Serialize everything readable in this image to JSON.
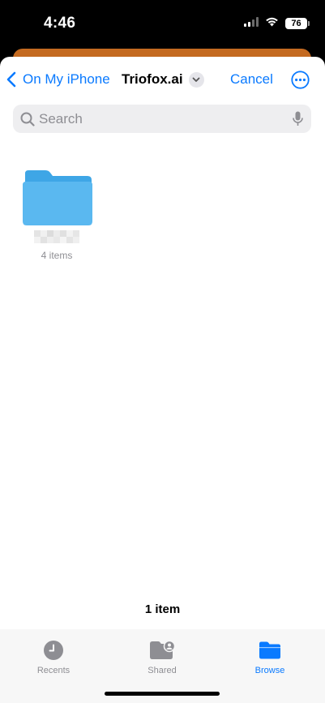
{
  "status_bar": {
    "time": "4:46",
    "battery_level": "76",
    "signal_icon": "cellular-signal-icon",
    "wifi_icon": "wifi-icon"
  },
  "nav": {
    "back_label": "On My iPhone",
    "title": "Triofox.ai",
    "cancel_label": "Cancel",
    "back_icon": "chevron-left-icon",
    "title_menu_icon": "chevron-down-icon",
    "more_icon": "ellipsis-circle-icon"
  },
  "search": {
    "placeholder": "Search",
    "icon": "search-icon",
    "mic_icon": "microphone-icon"
  },
  "files": [
    {
      "kind": "folder",
      "meta": "4 items",
      "icon": "folder-icon"
    }
  ],
  "footer": {
    "item_count": "1 item"
  },
  "tabs": [
    {
      "label": "Recents",
      "icon": "clock-icon",
      "active": false
    },
    {
      "label": "Shared",
      "icon": "shared-folder-icon",
      "active": false
    },
    {
      "label": "Browse",
      "icon": "folder-icon",
      "active": true
    }
  ],
  "colors": {
    "accent": "#0a7aff",
    "folder": "#5ab8f0",
    "sheet_behind": "#c46a20",
    "inactive_tab": "#8e8e93"
  }
}
